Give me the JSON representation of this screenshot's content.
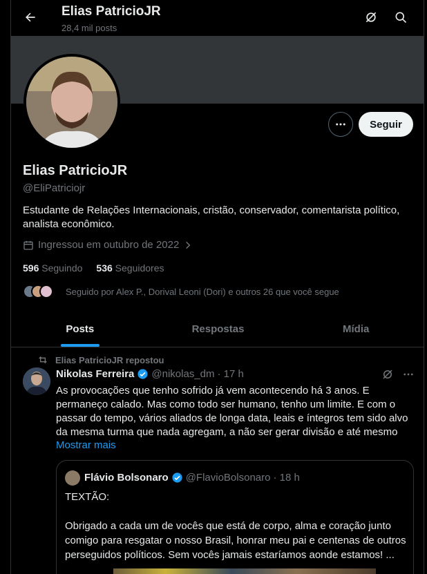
{
  "header": {
    "title": "Elias PatricioJR",
    "posts_count": "28,4 mil posts"
  },
  "profile": {
    "name": "Elias PatricioJR",
    "handle": "@EliPatriciojr",
    "bio": "Estudante de Relações Internacionais, cristão, conservador, comentarista político, analista econômico.",
    "joined": "Ingressou em outubro de 2022",
    "following_count": "596",
    "following_label": "Seguindo",
    "followers_count": "536",
    "followers_label": "Seguidores",
    "followed_by": "Seguido por Alex P., Dorival Leoni (Dori) e outros 26 que você segue",
    "follow_button": "Seguir"
  },
  "tabs": [
    {
      "label": "Posts",
      "active": true
    },
    {
      "label": "Respostas",
      "active": false
    },
    {
      "label": "Mídia",
      "active": false
    }
  ],
  "post": {
    "repost_label": "Elias PatricioJR repostou",
    "author_name": "Nikolas Ferreira",
    "author_handle": "@nikolas_dm",
    "time": "· 17 h",
    "text": "As provocações que tenho sofrido já vem acontecendo há 3 anos. E permaneço calado. Mas como todo ser humano, tenho um limite. E com o passar do tempo, vários aliados de longa data, leais e íntegros tem sido alvo da mesma turma que nada agregam, a não ser gerar divisão e até mesmo",
    "show_more": "Mostrar mais",
    "quote": {
      "author_name": "Flávio Bolsonaro",
      "author_handle": "@FlavioBolsonaro",
      "time": "· 18 h",
      "line1": "TEXTÃO:",
      "line2": "Obrigado a cada um de vocês que está de corpo, alma e coração junto comigo para resgatar o nosso Brasil, honrar meu pai e centenas de outros perseguidos políticos. Sem vocês jamais estaríamos aonde estamos! ..."
    }
  },
  "colors": {
    "accent": "#1d9bf0",
    "background": "#000000",
    "muted_text": "#71767b",
    "banner": "#333639"
  },
  "icons": [
    "back-arrow-icon",
    "grok-icon",
    "search-icon",
    "more-icon",
    "calendar-icon",
    "chevron-right-icon",
    "repost-icon",
    "verified-badge-icon"
  ]
}
